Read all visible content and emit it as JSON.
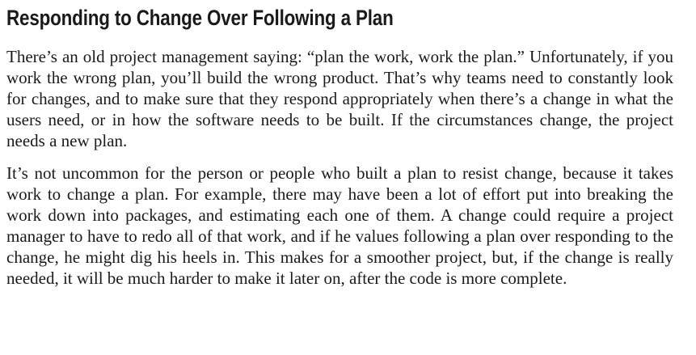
{
  "section": {
    "heading": "Responding to Change Over Following a Plan",
    "paragraphs": [
      "There’s an old project management saying: “plan the work, work the plan.” Unfortu­nately, if you work the wrong plan, you’ll build the wrong product. That’s why teams need to constantly look for changes, and to make sure that they respond appropri­ately when there’s a change in what the users need, or in how the software needs to be built. If the circumstances change, the project needs a new plan.",
      "It’s not uncommon for the person or people who built a plan to resist change, because it takes work to change a plan. For example, there may have been a lot of effort put into breaking the work down into packages, and estimating each one of them. A change could require a project manager to have to redo all of that work, and if he values following a plan over responding to the change, he might dig his heels in. This makes for a smoother project, but, if the change is really needed, it will be much harder to make it later on, after the code is more complete."
    ]
  }
}
